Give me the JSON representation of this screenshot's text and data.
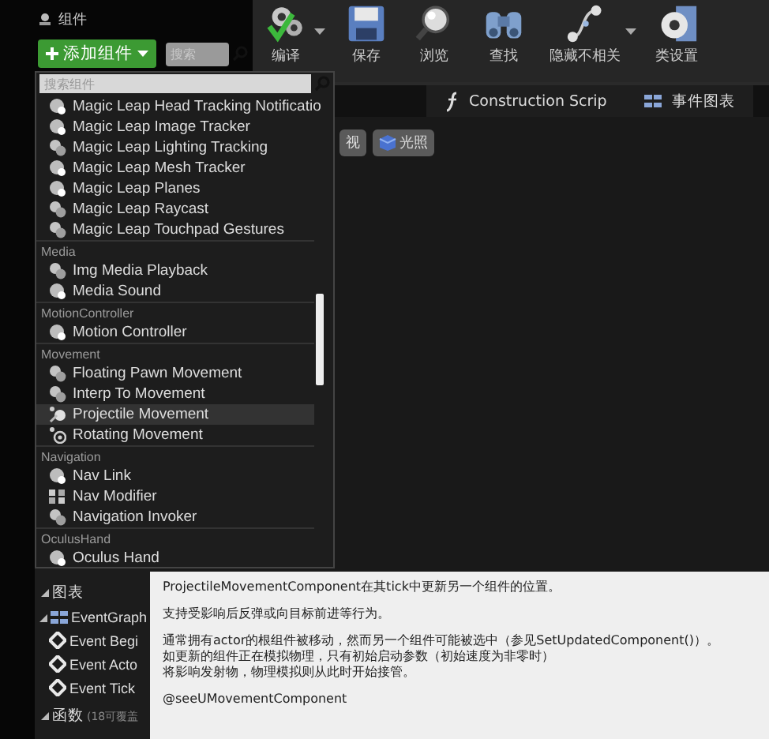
{
  "panel_title": "组件",
  "add_button": "添加组件",
  "search": {
    "placeholder": "搜索"
  },
  "toolbar": [
    {
      "label": "编译",
      "kind": "compile",
      "dropdown": true
    },
    {
      "label": "保存",
      "kind": "save",
      "dropdown": false
    },
    {
      "label": "浏览",
      "kind": "browse",
      "dropdown": false
    },
    {
      "label": "查找",
      "kind": "find",
      "dropdown": false
    },
    {
      "label": "隐藏不相关",
      "kind": "hide",
      "dropdown": true
    },
    {
      "label": "类设置",
      "kind": "settings",
      "dropdown": false
    }
  ],
  "tabs": [
    {
      "label": "Construction Scrip",
      "kind": "function",
      "selected": false
    },
    {
      "label": "事件图表",
      "kind": "graph",
      "selected": false
    }
  ],
  "viewport_buttons": [
    {
      "label": "视",
      "kind": "plain"
    },
    {
      "label": "光照",
      "kind": "lit"
    }
  ],
  "popup": {
    "search": {
      "placeholder": "搜索组件"
    },
    "groups": [
      {
        "items": [
          {
            "label": "Magic Leap Head Tracking Notificatio",
            "kind": "sphere",
            "selected": false
          },
          {
            "label": "Magic Leap Image Tracker",
            "kind": "sphere",
            "selected": false
          },
          {
            "label": "Magic Leap Lighting Tracking",
            "kind": "gears",
            "selected": false
          },
          {
            "label": "Magic Leap Mesh Tracker",
            "kind": "sphere",
            "selected": false
          },
          {
            "label": "Magic Leap Planes",
            "kind": "sphere",
            "selected": false
          },
          {
            "label": "Magic Leap Raycast",
            "kind": "gears",
            "selected": false
          },
          {
            "label": "Magic Leap Touchpad Gestures",
            "kind": "gears",
            "selected": false
          }
        ]
      },
      {
        "title": "Media",
        "items": [
          {
            "label": "Img Media Playback",
            "kind": "gears",
            "selected": false
          },
          {
            "label": "Media Sound",
            "kind": "sphere",
            "selected": false
          }
        ]
      },
      {
        "title": "MotionController",
        "items": [
          {
            "label": "Motion Controller",
            "kind": "sphere",
            "selected": false
          }
        ]
      },
      {
        "title": "Movement",
        "items": [
          {
            "label": "Floating Pawn Movement",
            "kind": "gears",
            "selected": false
          },
          {
            "label": "Interp To Movement",
            "kind": "gears",
            "selected": false
          },
          {
            "label": "Projectile Movement",
            "kind": "projectile",
            "selected": true
          },
          {
            "label": "Rotating Movement",
            "kind": "rotating",
            "selected": false
          }
        ]
      },
      {
        "title": "Navigation",
        "items": [
          {
            "label": "Nav Link",
            "kind": "sphere",
            "selected": false
          },
          {
            "label": "Nav Modifier",
            "kind": "grid",
            "selected": false
          },
          {
            "label": "Navigation Invoker",
            "kind": "gears",
            "selected": false
          }
        ]
      },
      {
        "title": "OculusHand",
        "items": [
          {
            "label": "Oculus Hand",
            "kind": "sphere",
            "selected": false
          }
        ]
      }
    ]
  },
  "my_blueprint": {
    "sections": [
      {
        "title": "图表",
        "items": [
          {
            "label": "EventGraph",
            "kind": "graph",
            "children": [
              {
                "label": "Event Begi",
                "kind": "event"
              },
              {
                "label": "Event Acto",
                "kind": "event"
              },
              {
                "label": "Event Tick",
                "kind": "event"
              }
            ]
          }
        ]
      },
      {
        "title": "函数",
        "note": "(18可覆盖"
      }
    ]
  },
  "tooltip": {
    "paragraphs": [
      [
        "ProjectileMovementComponent在其tick中更新另一个组件的位置。"
      ],
      [
        "支持受影响后反弹或向目标前进等行为。"
      ],
      [
        "通常拥有actor的根组件被移动，然而另一个组件可能被选中（参见SetUpdatedComponent()）。",
        "如更新的组件正在模拟物理，只有初始启动参数（初始速度为非零时）",
        "将影响发射物，物理模拟则从此时开始接管。"
      ],
      [
        "@seeUMovementComponent"
      ]
    ]
  }
}
